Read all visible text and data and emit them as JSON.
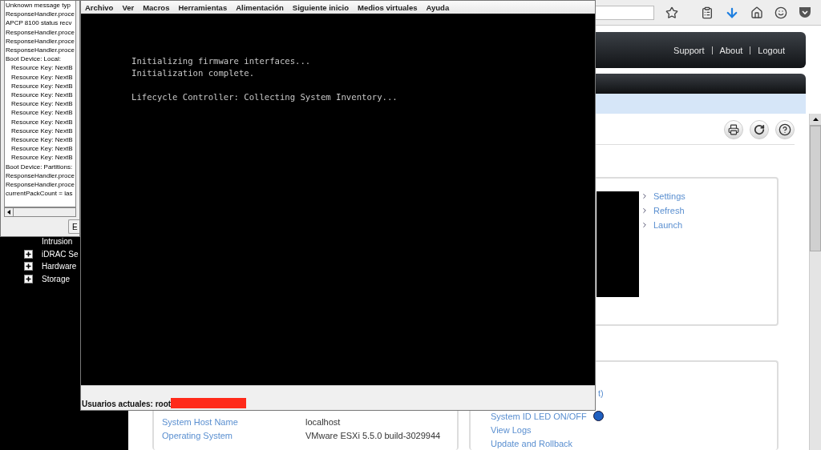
{
  "browser": {
    "header_links": [
      "Support",
      "About",
      "Logout"
    ],
    "sidebar_tree": [
      {
        "kind": "leaf",
        "label": "Intrusion"
      },
      {
        "kind": "node",
        "label": "iDRAC Se",
        "expanded": false
      },
      {
        "kind": "node",
        "label": "Hardware",
        "expanded": false
      },
      {
        "kind": "node",
        "label": "Storage",
        "expanded": false
      }
    ],
    "card_links": [
      "Settings",
      "Refresh",
      "Launch"
    ],
    "summary_rows": [
      {
        "label": "System Host Name",
        "value": "localhost"
      },
      {
        "label": "Operating System",
        "value": "VMware ESXi 5.5.0 build-3029944"
      }
    ],
    "quick_links": [
      {
        "kind": "link",
        "text": "t)"
      },
      {
        "kind": "led",
        "text": "System ID LED ON/OFF",
        "on": true
      },
      {
        "kind": "link",
        "text": "View Logs"
      },
      {
        "kind": "link",
        "text": "Update and Rollback"
      }
    ]
  },
  "log_window": {
    "lines": [
      {
        "text": "Unknown message typ"
      },
      {
        "text": "ResponseHandler.proce"
      },
      {
        "text": "APCP 8100 status recv"
      },
      {
        "text": "ResponseHandler.proce"
      },
      {
        "text": "ResponseHandler.proce"
      },
      {
        "text": "ResponseHandler.proce"
      },
      {
        "text": "Boot Device: Local:",
        "children": [
          {
            "text": "Resource Key: NextB"
          },
          {
            "text": "Resource Key: NextB"
          },
          {
            "text": "Resource Key: NextB"
          },
          {
            "text": "Resource Key: NextB"
          },
          {
            "text": "Resource Key: NextB"
          },
          {
            "text": "Resource Key: NextB"
          },
          {
            "text": "Resource Key: NextB"
          },
          {
            "text": "Resource Key: NextB"
          },
          {
            "text": "Resource Key: NextB"
          },
          {
            "text": "Resource Key: NextB"
          },
          {
            "text": "Resource Key: NextB"
          }
        ]
      },
      {
        "text": "Boot Device: Partitions:"
      },
      {
        "text": "ResponseHandler.proce"
      },
      {
        "text": "ResponseHandler.proce"
      },
      {
        "text": "currentPackCount = las"
      }
    ],
    "button": "E"
  },
  "console": {
    "menu": [
      "Archivo",
      "Ver",
      "Macros",
      "Herramientas",
      "Alimentación",
      "Siguiente inicio",
      "Medios virtuales",
      "Ayuda"
    ],
    "screen_blocks": [
      {
        "lines": [
          "Initializing firmware interfaces...",
          "Initialization complete."
        ]
      },
      {
        "lines": [
          "Lifecycle Controller: Collecting System Inventory..."
        ]
      }
    ],
    "status": "Usuarios actuales: root"
  }
}
